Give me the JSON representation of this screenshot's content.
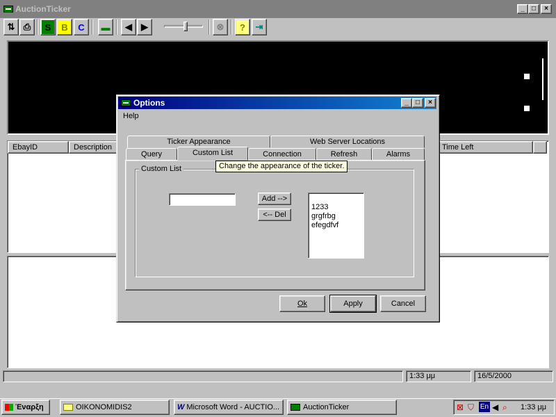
{
  "main_window": {
    "title": "AuctionTicker",
    "caption": {
      "minimize": "_",
      "maximize": "□",
      "close": "×"
    }
  },
  "toolbar": {
    "buttons": [
      {
        "name": "sort-icon",
        "glyph": "⇅"
      },
      {
        "name": "print-icon",
        "glyph": "⎙"
      },
      {
        "name": "s-button",
        "glyph": "S",
        "color": "#008000"
      },
      {
        "name": "b-button",
        "glyph": "B",
        "color": "#ffff00"
      },
      {
        "name": "c-button",
        "glyph": "C",
        "color": "#0000ff"
      },
      {
        "name": "ticker-icon",
        "glyph": "▬"
      },
      {
        "name": "back-arrow-icon",
        "glyph": "◀"
      },
      {
        "name": "forward-arrow-icon",
        "glyph": "▶"
      },
      {
        "name": "stop-icon",
        "glyph": "⊗"
      },
      {
        "name": "help-icon",
        "glyph": "?"
      },
      {
        "name": "exit-icon",
        "glyph": "⇥"
      }
    ],
    "speed_slider_level": 0.55
  },
  "grid": {
    "columns": [
      "EbayID",
      "Description",
      "Time Left"
    ]
  },
  "statusbar": {
    "time": "1:33 μμ",
    "date": "16/5/2000"
  },
  "dialog": {
    "title": "Options",
    "menu_help": "Help",
    "tabs_row1": [
      "Ticker Appearance",
      "Web Server Locations"
    ],
    "tabs_row2": [
      "Query",
      "Custom List",
      "Connection",
      "Refresh",
      "Alarms"
    ],
    "active_tab": "Custom List",
    "tooltip": "Change the appearance of the ticker.",
    "groupbox_label": "Custom List",
    "input_value": "",
    "add_button": "Add -->",
    "del_button": "<-- Del",
    "list_items": [
      "1233",
      "grgfrbg",
      "efegdfvf"
    ],
    "ok_button": "Ok",
    "apply_button": "Apply",
    "cancel_button": "Cancel"
  },
  "taskbar": {
    "start": "Έναρξη",
    "tasks": [
      "OIKONOMIDIS2",
      "Microsoft Word - AUCTIO...",
      "AuctionTicker"
    ],
    "tray_lang": "En",
    "tray_time": "1:33 μμ"
  }
}
